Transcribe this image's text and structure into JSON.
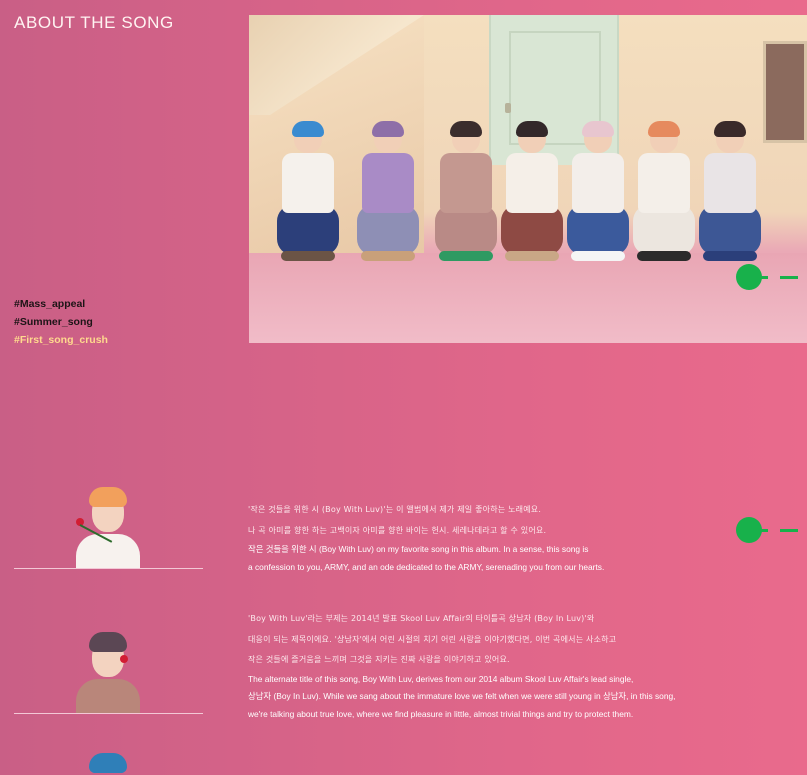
{
  "section": {
    "title": "ABOUT THE SONG"
  },
  "hashtags": [
    {
      "label": "#Mass_appeal",
      "highlighted": false
    },
    {
      "label": "#Summer_song",
      "highlighted": false
    },
    {
      "label": "#First_song_crush",
      "highlighted": true
    }
  ],
  "colors": {
    "background_left": "#c95f86",
    "background_right": "#e96a8c",
    "highlight_tag": "#ffd98e",
    "marker": "#18b14b"
  },
  "quotes": [
    {
      "korean": [
        "'작은 것들을 위한 시 (Boy With Luv)'는 이 앨범에서 제가 제일 좋아하는 노래예요.",
        "나 곡 아미를 향한 하는 고백이자 아미를 향한 바이는 헌시. 세레나데라고 할 수 있어요."
      ],
      "english": [
        "작은 것들을 위한 시 (Boy With Luv) on my favorite song in this album. In a sense, this song is",
        "a confession to you, ARMY, and an ode dedicated to the ARMY, serenading you from our hearts."
      ]
    },
    {
      "korean": [
        "'Boy With Luv'라는 부제는 2014년 발표 Skool Luv Affair의 타이틀곡 상남자 (Boy In Luv)'와",
        "대응이 되는 제목이에요. '상남자'에서 어린 시절의 치기 어린 사랑을 이야기했다면, 이번 곡에서는 사소하고",
        "작은 것들에 즐거움을 느끼며 그것을 지키는 진짜 사랑을 이야기하고 있어요."
      ],
      "english": [
        "The alternate title of this song, Boy With Luv, derives from our 2014 album Skool Luv Affair's lead single,",
        "상남자 (Boy In Luv). While we sang about the immature love we felt when we were still young in 상남자, in this song,",
        "we're talking about true love, where we find pleasure in little, almost trivial things and try to protect them."
      ]
    }
  ]
}
